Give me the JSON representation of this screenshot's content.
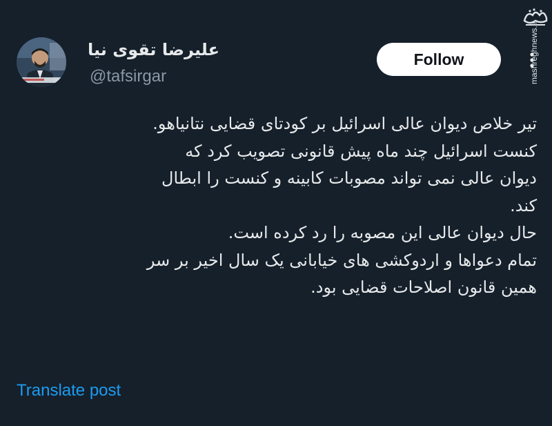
{
  "tweet": {
    "author": {
      "display_name": "علیرضا تقوی نیا",
      "handle": "@tafsirgar"
    },
    "follow_label": "Follow",
    "lines": [
      "تیر خلاص دیوان عالی اسرائیل بر کودتای قضایی نتانیاهو.",
      "کنست اسرائیل چند ماه پیش قانونی تصویب کرد که",
      "دیوان عالی نمی تواند مصوبات کابینه و کنست را ابطال",
      "کند.",
      "حال دیوان عالی این مصوبه را رد کرده است.",
      "تمام دعواها و اردوکشی های خیابانی یک سال اخیر بر سر",
      "همین قانون اصلاحات قضایی بود."
    ],
    "translate_label": "Translate post"
  },
  "watermark": {
    "logo_text": "مشرق",
    "site": "mashreghnews.ir"
  },
  "colors": {
    "background": "#15202b",
    "text": "#e7e9ea",
    "secondary_text": "#8b98a5",
    "link": "#1d9bf0",
    "button_bg": "#ffffff",
    "button_text": "#0f1419"
  },
  "icons": {
    "more": "more-vertical-icon",
    "avatar": "avatar-photo"
  }
}
